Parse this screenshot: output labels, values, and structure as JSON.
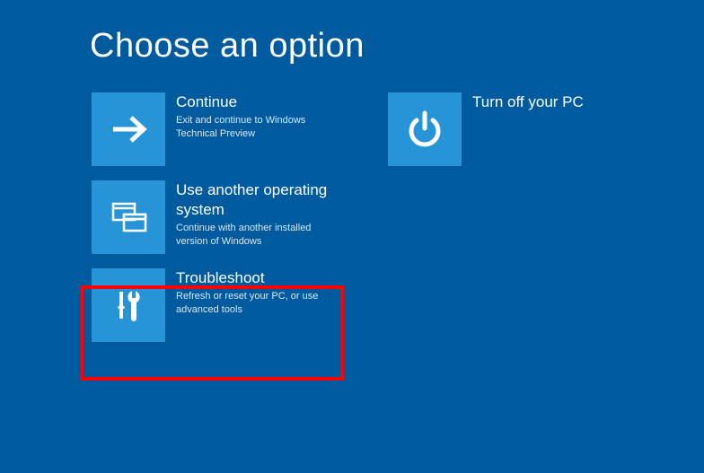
{
  "title": "Choose an option",
  "options": [
    {
      "label": "Continue",
      "desc": "Exit and continue to Windows Technical Preview",
      "icon": "arrow-right-icon"
    },
    {
      "label": "Use another operating system",
      "desc": "Continue with another installed version of Windows",
      "icon": "windows-icon"
    },
    {
      "label": "Troubleshoot",
      "desc": "Refresh or reset your PC, or use advanced tools",
      "icon": "tools-icon"
    },
    {
      "label": "Turn off your PC",
      "desc": "",
      "icon": "power-icon"
    }
  ],
  "highlighted_index": 2
}
